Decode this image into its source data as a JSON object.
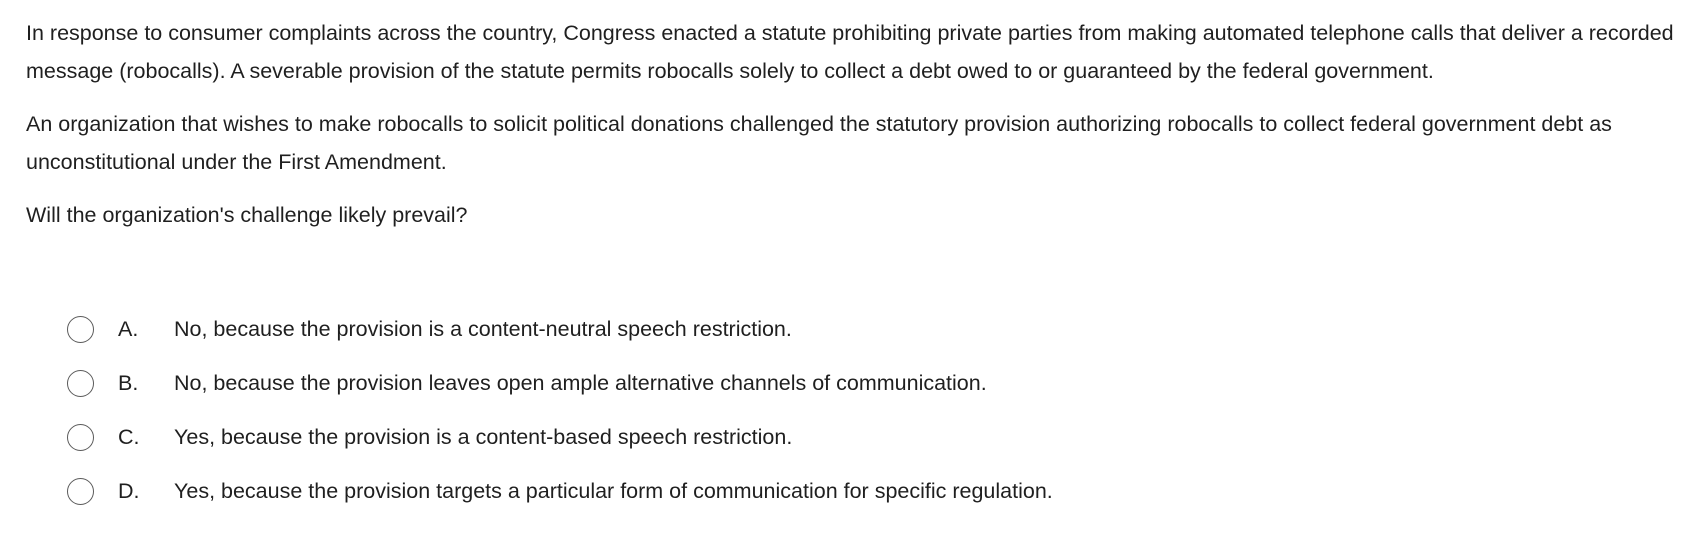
{
  "question": {
    "paragraphs": [
      "In response to consumer complaints across the country, Congress enacted a statute prohibiting private parties from making automated telephone calls that deliver a recorded message (robocalls).  A severable provision of the statute permits robocalls solely to collect a debt owed to or guaranteed by the federal government.",
      "An organization that wishes to make robocalls to solicit political donations challenged the statutory provision authorizing robocalls to collect federal government debt as unconstitutional under the First Amendment."
    ],
    "prompt": "Will the organization's challenge likely prevail?"
  },
  "choices": [
    {
      "letter": "A.",
      "text": "No, because the provision is a content-neutral speech restriction.",
      "selected": false
    },
    {
      "letter": "B.",
      "text": "No, because the provision leaves open ample alternative channels of communication.",
      "selected": false
    },
    {
      "letter": "C.",
      "text": "Yes, because the provision is a content-based speech restriction.",
      "selected": false
    },
    {
      "letter": "D.",
      "text": "Yes, because the provision targets a particular form of communication for specific regulation.",
      "selected": false
    }
  ]
}
